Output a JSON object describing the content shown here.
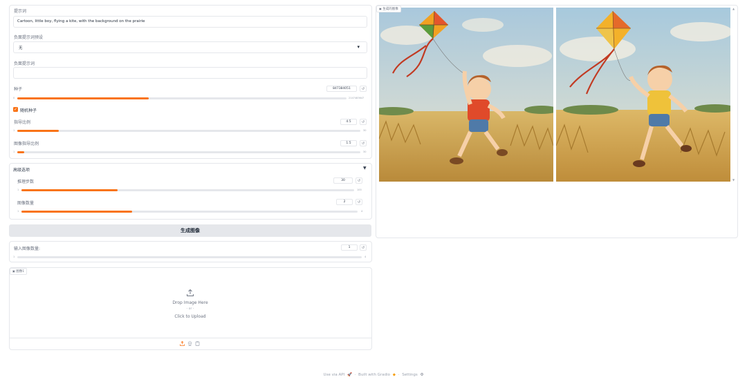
{
  "prompt": {
    "label": "提示词",
    "value": "Cartoon, little boy, flying a kite, with the background on the prairie"
  },
  "negative_preset": {
    "label": "负面提示词预设",
    "value": "无"
  },
  "negative_prompt": {
    "label": "负面提示词",
    "value": ""
  },
  "seed": {
    "label": "种子",
    "value": "847384051",
    "min": "0",
    "max": "2147483647",
    "fraction": 0.4
  },
  "random_seed": {
    "label": "随机种子",
    "checked": true
  },
  "guidance": {
    "label": "指导比例",
    "value": "4.5",
    "min": "1",
    "max": "30",
    "fraction": 0.12
  },
  "image_guidance": {
    "label": "图像指导比例",
    "value": "1.5",
    "min": "1",
    "max": "30",
    "fraction": 0.02
  },
  "advanced": {
    "label": "高级选项",
    "toggle_icon": "▼",
    "steps": {
      "label": "推理步数",
      "value": "30",
      "min": "1",
      "max": "100",
      "fraction": 0.29
    },
    "num_images": {
      "label": "图像数量",
      "value": "2",
      "min": "1",
      "max": "4",
      "fraction": 0.33
    }
  },
  "generate_button": "生成图像",
  "input_count": {
    "label": "输入图像数量:",
    "value": "1",
    "min": "1",
    "max": "4",
    "fraction": 0.0
  },
  "upload": {
    "badge": "图像1",
    "drop_text": "Drop Image Here",
    "or_text": "- or -",
    "click_text": "Click to Upload"
  },
  "gallery": {
    "label": "生成的图像"
  },
  "footer": {
    "api": "Use via API",
    "built": "Built with Gradio",
    "settings": "Settings"
  },
  "icons": {
    "reset": "↺",
    "dropdown": "▾",
    "upload": "upload-icon",
    "webcam": "webcam-icon",
    "clipboard": "clipboard-icon"
  },
  "colors": {
    "accent": "#f97316",
    "border": "#e5e7eb",
    "button": "#e5e7eb"
  }
}
